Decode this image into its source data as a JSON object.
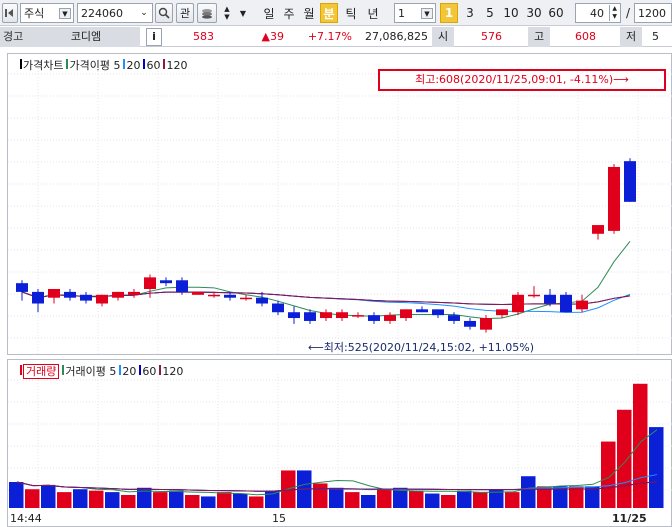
{
  "toolbar": {
    "market_select": "주식",
    "code_input": "224060",
    "search_icon": "magnifier-icon",
    "watch_label": "관",
    "periods": [
      "일",
      "주",
      "월",
      "분",
      "틱",
      "년"
    ],
    "active_period": "분",
    "interval_select": "1",
    "quick_intervals": [
      "1",
      "3",
      "5",
      "10",
      "30",
      "60"
    ],
    "active_interval": "1",
    "view_count": "40",
    "slash": "/",
    "total_count": "1200"
  },
  "info": {
    "warning_label": "경고",
    "stock_name": "코디엠",
    "info_label": "i",
    "price": "583",
    "change": "▲39",
    "change_pct": "+7.17%",
    "volume": "27,086,825",
    "open_label": "시",
    "open": "576",
    "high_label": "고",
    "high": "608",
    "low_label": "저",
    "low_partial": "5"
  },
  "price_panel": {
    "legend": [
      {
        "label": "가격차트",
        "color": "#000000"
      },
      {
        "label": "가격이평 5",
        "color": "#2e8b57"
      },
      {
        "label": "20",
        "color": "#1e90ff"
      },
      {
        "label": "60",
        "color": "#0000cd"
      },
      {
        "label": "120",
        "color": "#8b1a4a"
      }
    ],
    "high_callout": "최고:608(2020/11/25,09:01, -4.11%)⟶",
    "low_annotation": "⟵최저:525(2020/11/24,15:02, +11.05%)"
  },
  "volume_panel": {
    "legend": [
      {
        "label": "거래량",
        "color": "#e0001b"
      },
      {
        "label": "거래이평 5",
        "color": "#2e8b57"
      },
      {
        "label": "20",
        "color": "#1e90ff"
      },
      {
        "label": "60",
        "color": "#0000cd"
      },
      {
        "label": "120",
        "color": "#8b1a4a"
      }
    ]
  },
  "x_axis": {
    "labels": [
      "14:44",
      "15",
      "11/25"
    ]
  },
  "colors": {
    "up": "#e0001b",
    "down": "#0a1fd6"
  },
  "chart_data": {
    "type": "candlestick",
    "ohlc": [
      {
        "o": 538,
        "h": 539,
        "l": 532,
        "c": 535
      },
      {
        "o": 535,
        "h": 536,
        "l": 528,
        "c": 531
      },
      {
        "o": 533,
        "h": 536,
        "l": 531,
        "c": 536
      },
      {
        "o": 535,
        "h": 536,
        "l": 532,
        "c": 533
      },
      {
        "o": 534,
        "h": 535,
        "l": 531,
        "c": 532
      },
      {
        "o": 531,
        "h": 534,
        "l": 530,
        "c": 534
      },
      {
        "o": 533,
        "h": 535,
        "l": 532,
        "c": 535
      },
      {
        "o": 534,
        "h": 536,
        "l": 533,
        "c": 535
      },
      {
        "o": 536,
        "h": 541,
        "l": 533,
        "c": 540
      },
      {
        "o": 539,
        "h": 540,
        "l": 537,
        "c": 538
      },
      {
        "o": 539,
        "h": 540,
        "l": 534,
        "c": 535
      },
      {
        "o": 534,
        "h": 535,
        "l": 534,
        "c": 535
      },
      {
        "o": 534,
        "h": 535,
        "l": 533,
        "c": 534
      },
      {
        "o": 534,
        "h": 535,
        "l": 532,
        "c": 533
      },
      {
        "o": 533,
        "h": 534,
        "l": 532,
        "c": 533
      },
      {
        "o": 533,
        "h": 535,
        "l": 530,
        "c": 531
      },
      {
        "o": 531,
        "h": 532,
        "l": 527,
        "c": 528
      },
      {
        "o": 528,
        "h": 530,
        "l": 524,
        "c": 526
      },
      {
        "o": 528,
        "h": 529,
        "l": 524,
        "c": 525
      },
      {
        "o": 526,
        "h": 529,
        "l": 525,
        "c": 528
      },
      {
        "o": 526,
        "h": 529,
        "l": 525,
        "c": 528
      },
      {
        "o": 527,
        "h": 528,
        "l": 526,
        "c": 527
      },
      {
        "o": 527,
        "h": 528,
        "l": 524,
        "c": 525
      },
      {
        "o": 525,
        "h": 528,
        "l": 524,
        "c": 527
      },
      {
        "o": 526,
        "h": 529,
        "l": 525,
        "c": 529
      },
      {
        "o": 529,
        "h": 530,
        "l": 528,
        "c": 528
      },
      {
        "o": 529,
        "h": 529,
        "l": 526,
        "c": 527
      },
      {
        "o": 527,
        "h": 528,
        "l": 524,
        "c": 525
      },
      {
        "o": 525,
        "h": 526,
        "l": 522,
        "c": 523
      },
      {
        "o": 522,
        "h": 527,
        "l": 521,
        "c": 526
      },
      {
        "o": 527,
        "h": 529,
        "l": 526,
        "c": 529
      },
      {
        "o": 528,
        "h": 535,
        "l": 527,
        "c": 534
      },
      {
        "o": 534,
        "h": 537,
        "l": 533,
        "c": 534
      },
      {
        "o": 534,
        "h": 536,
        "l": 530,
        "c": 531
      },
      {
        "o": 534,
        "h": 535,
        "l": 528,
        "c": 528
      },
      {
        "o": 529,
        "h": 534,
        "l": 528,
        "c": 532
      },
      {
        "o": 555,
        "h": 558,
        "l": 553,
        "c": 558
      },
      {
        "o": 556,
        "h": 579,
        "l": 555,
        "c": 578
      },
      {
        "o": 580,
        "h": 581,
        "l": 566,
        "c": 566
      }
    ],
    "volume": [
      18,
      13,
      16,
      11,
      13,
      12,
      11,
      9,
      14,
      11,
      12,
      9,
      8,
      11,
      10,
      8,
      12,
      26,
      26,
      17,
      14,
      11,
      9,
      13,
      14,
      12,
      10,
      9,
      12,
      11,
      13,
      11,
      22,
      15,
      15,
      15,
      15,
      46,
      68,
      86,
      56
    ]
  }
}
